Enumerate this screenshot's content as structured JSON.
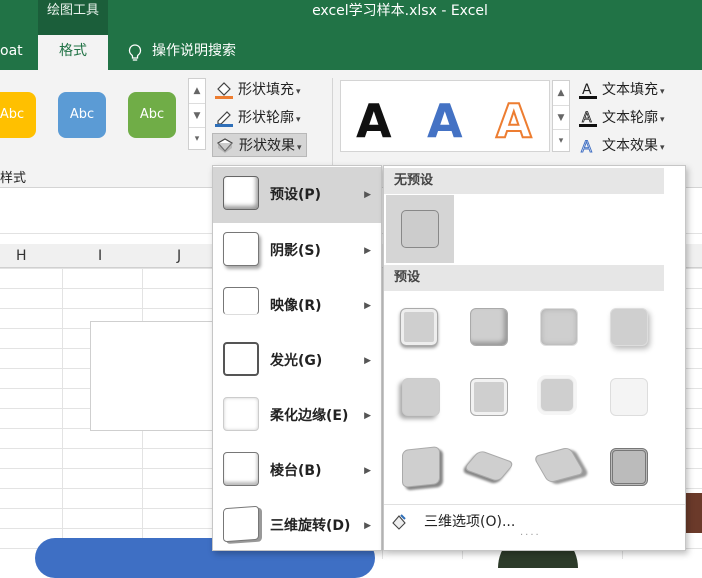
{
  "title_bar": {
    "context_group": "绘图工具",
    "window_title": "excel学习样本.xlsx  -  Excel"
  },
  "tabs": {
    "prev_tab_partial": "oat",
    "active_tab": "格式",
    "tell_me": "操作说明搜索"
  },
  "ribbon": {
    "shape_styles": [
      {
        "label": "Abc",
        "color": "#ffc000"
      },
      {
        "label": "Abc",
        "color": "#5b9bd5"
      },
      {
        "label": "Abc",
        "color": "#70ad47"
      }
    ],
    "shape_fill": "形状填充",
    "shape_outline": "形状轮廓",
    "shape_effects": "形状效果",
    "group_label_partial": "样式",
    "wordart": [
      {
        "label": "A",
        "color": "#111111"
      },
      {
        "label": "A",
        "color": "#4472c4"
      },
      {
        "label": "A",
        "color": "#ed7d31"
      }
    ],
    "text_fill": "文本填充",
    "text_outline": "文本轮廓",
    "text_effects": "文本效果"
  },
  "columns": [
    "H",
    "I",
    "J"
  ],
  "effects_menu": {
    "items": [
      {
        "label": "预设(P)"
      },
      {
        "label": "阴影(S)"
      },
      {
        "label": "映像(R)"
      },
      {
        "label": "发光(G)"
      },
      {
        "label": "柔化边缘(E)"
      },
      {
        "label": "棱台(B)"
      },
      {
        "label": "三维旋转(D)"
      }
    ]
  },
  "preset_panel": {
    "no_preset_header": "无预设",
    "preset_header": "预设",
    "footer": "三维选项(O)..."
  },
  "colors": {
    "excel_green": "#217346",
    "menu_highlight": "#d5d5d5"
  }
}
